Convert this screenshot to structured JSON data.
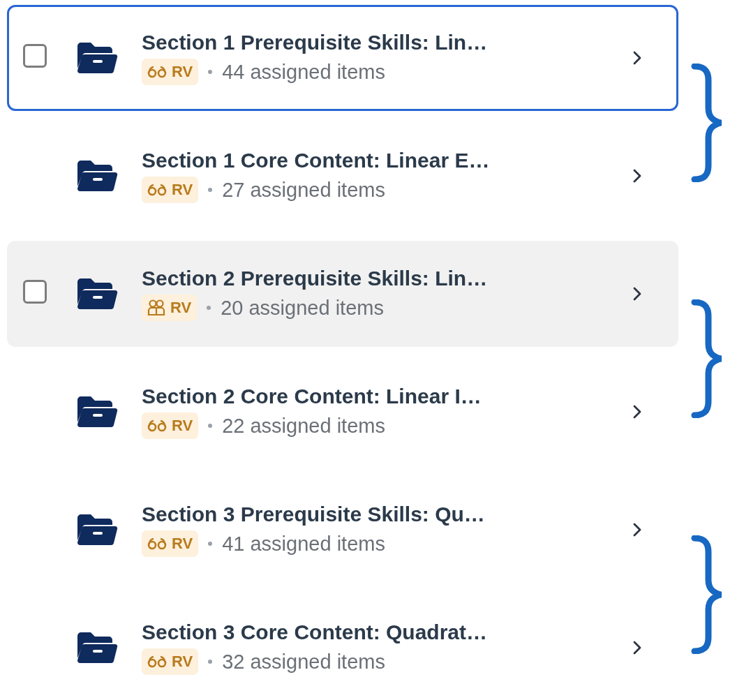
{
  "groups": [
    {
      "items": [
        {
          "title": "Section 1 Prerequisite Skills: Lin…",
          "badge": {
            "kind": "glasses",
            "label": "RV"
          },
          "count": "44 assigned items",
          "focused": true,
          "hovered": false,
          "checkbox_shown": true
        },
        {
          "title": "Section 1 Core Content: Linear E…",
          "badge": {
            "kind": "glasses",
            "label": "RV"
          },
          "count": "27 assigned items",
          "focused": false,
          "hovered": false,
          "checkbox_shown": false
        }
      ]
    },
    {
      "items": [
        {
          "title": "Section 2 Prerequisite Skills: Lin…",
          "badge": {
            "kind": "group",
            "label": "RV"
          },
          "count": "20 assigned items",
          "focused": false,
          "hovered": true,
          "checkbox_shown": true
        },
        {
          "title": "Section 2 Core Content: Linear I…",
          "badge": {
            "kind": "glasses",
            "label": "RV"
          },
          "count": "22 assigned items",
          "focused": false,
          "hovered": false,
          "checkbox_shown": false
        }
      ]
    },
    {
      "items": [
        {
          "title": "Section 3 Prerequisite Skills: Qu…",
          "badge": {
            "kind": "glasses",
            "label": "RV"
          },
          "count": "41 assigned items",
          "focused": false,
          "hovered": false,
          "checkbox_shown": false
        },
        {
          "title": "Section 3 Core Content: Quadrat…",
          "badge": {
            "kind": "glasses",
            "label": "RV"
          },
          "count": "32 assigned items",
          "focused": false,
          "hovered": false,
          "checkbox_shown": false
        }
      ]
    }
  ]
}
